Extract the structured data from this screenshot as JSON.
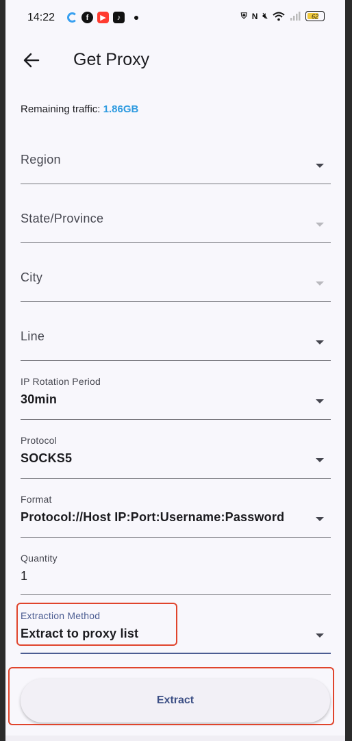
{
  "status_bar": {
    "time": "14:22",
    "battery": "62",
    "battery_color": "#f0c93c"
  },
  "app_bar": {
    "title": "Get Proxy"
  },
  "traffic": {
    "label": "Remaining traffic:",
    "value": "1.86GB",
    "value_color": "#2f9be0"
  },
  "fields": {
    "region": {
      "placeholder": "Region"
    },
    "state": {
      "placeholder": "State/Province"
    },
    "city": {
      "placeholder": "City"
    },
    "line": {
      "placeholder": "Line"
    },
    "rotation": {
      "label": "IP Rotation Period",
      "value": "30min"
    },
    "protocol": {
      "label": "Protocol",
      "value": "SOCKS5"
    },
    "format": {
      "label": "Format",
      "value": "Protocol://Host IP:Port:Username:Password"
    },
    "quantity": {
      "label": "Quantity",
      "value": "1"
    },
    "extraction": {
      "label": "Extraction Method",
      "value": "Extract to proxy list"
    }
  },
  "extract_button": {
    "label": "Extract"
  },
  "colors": {
    "accent": "#4c5d92",
    "highlight": "#e0442c"
  }
}
